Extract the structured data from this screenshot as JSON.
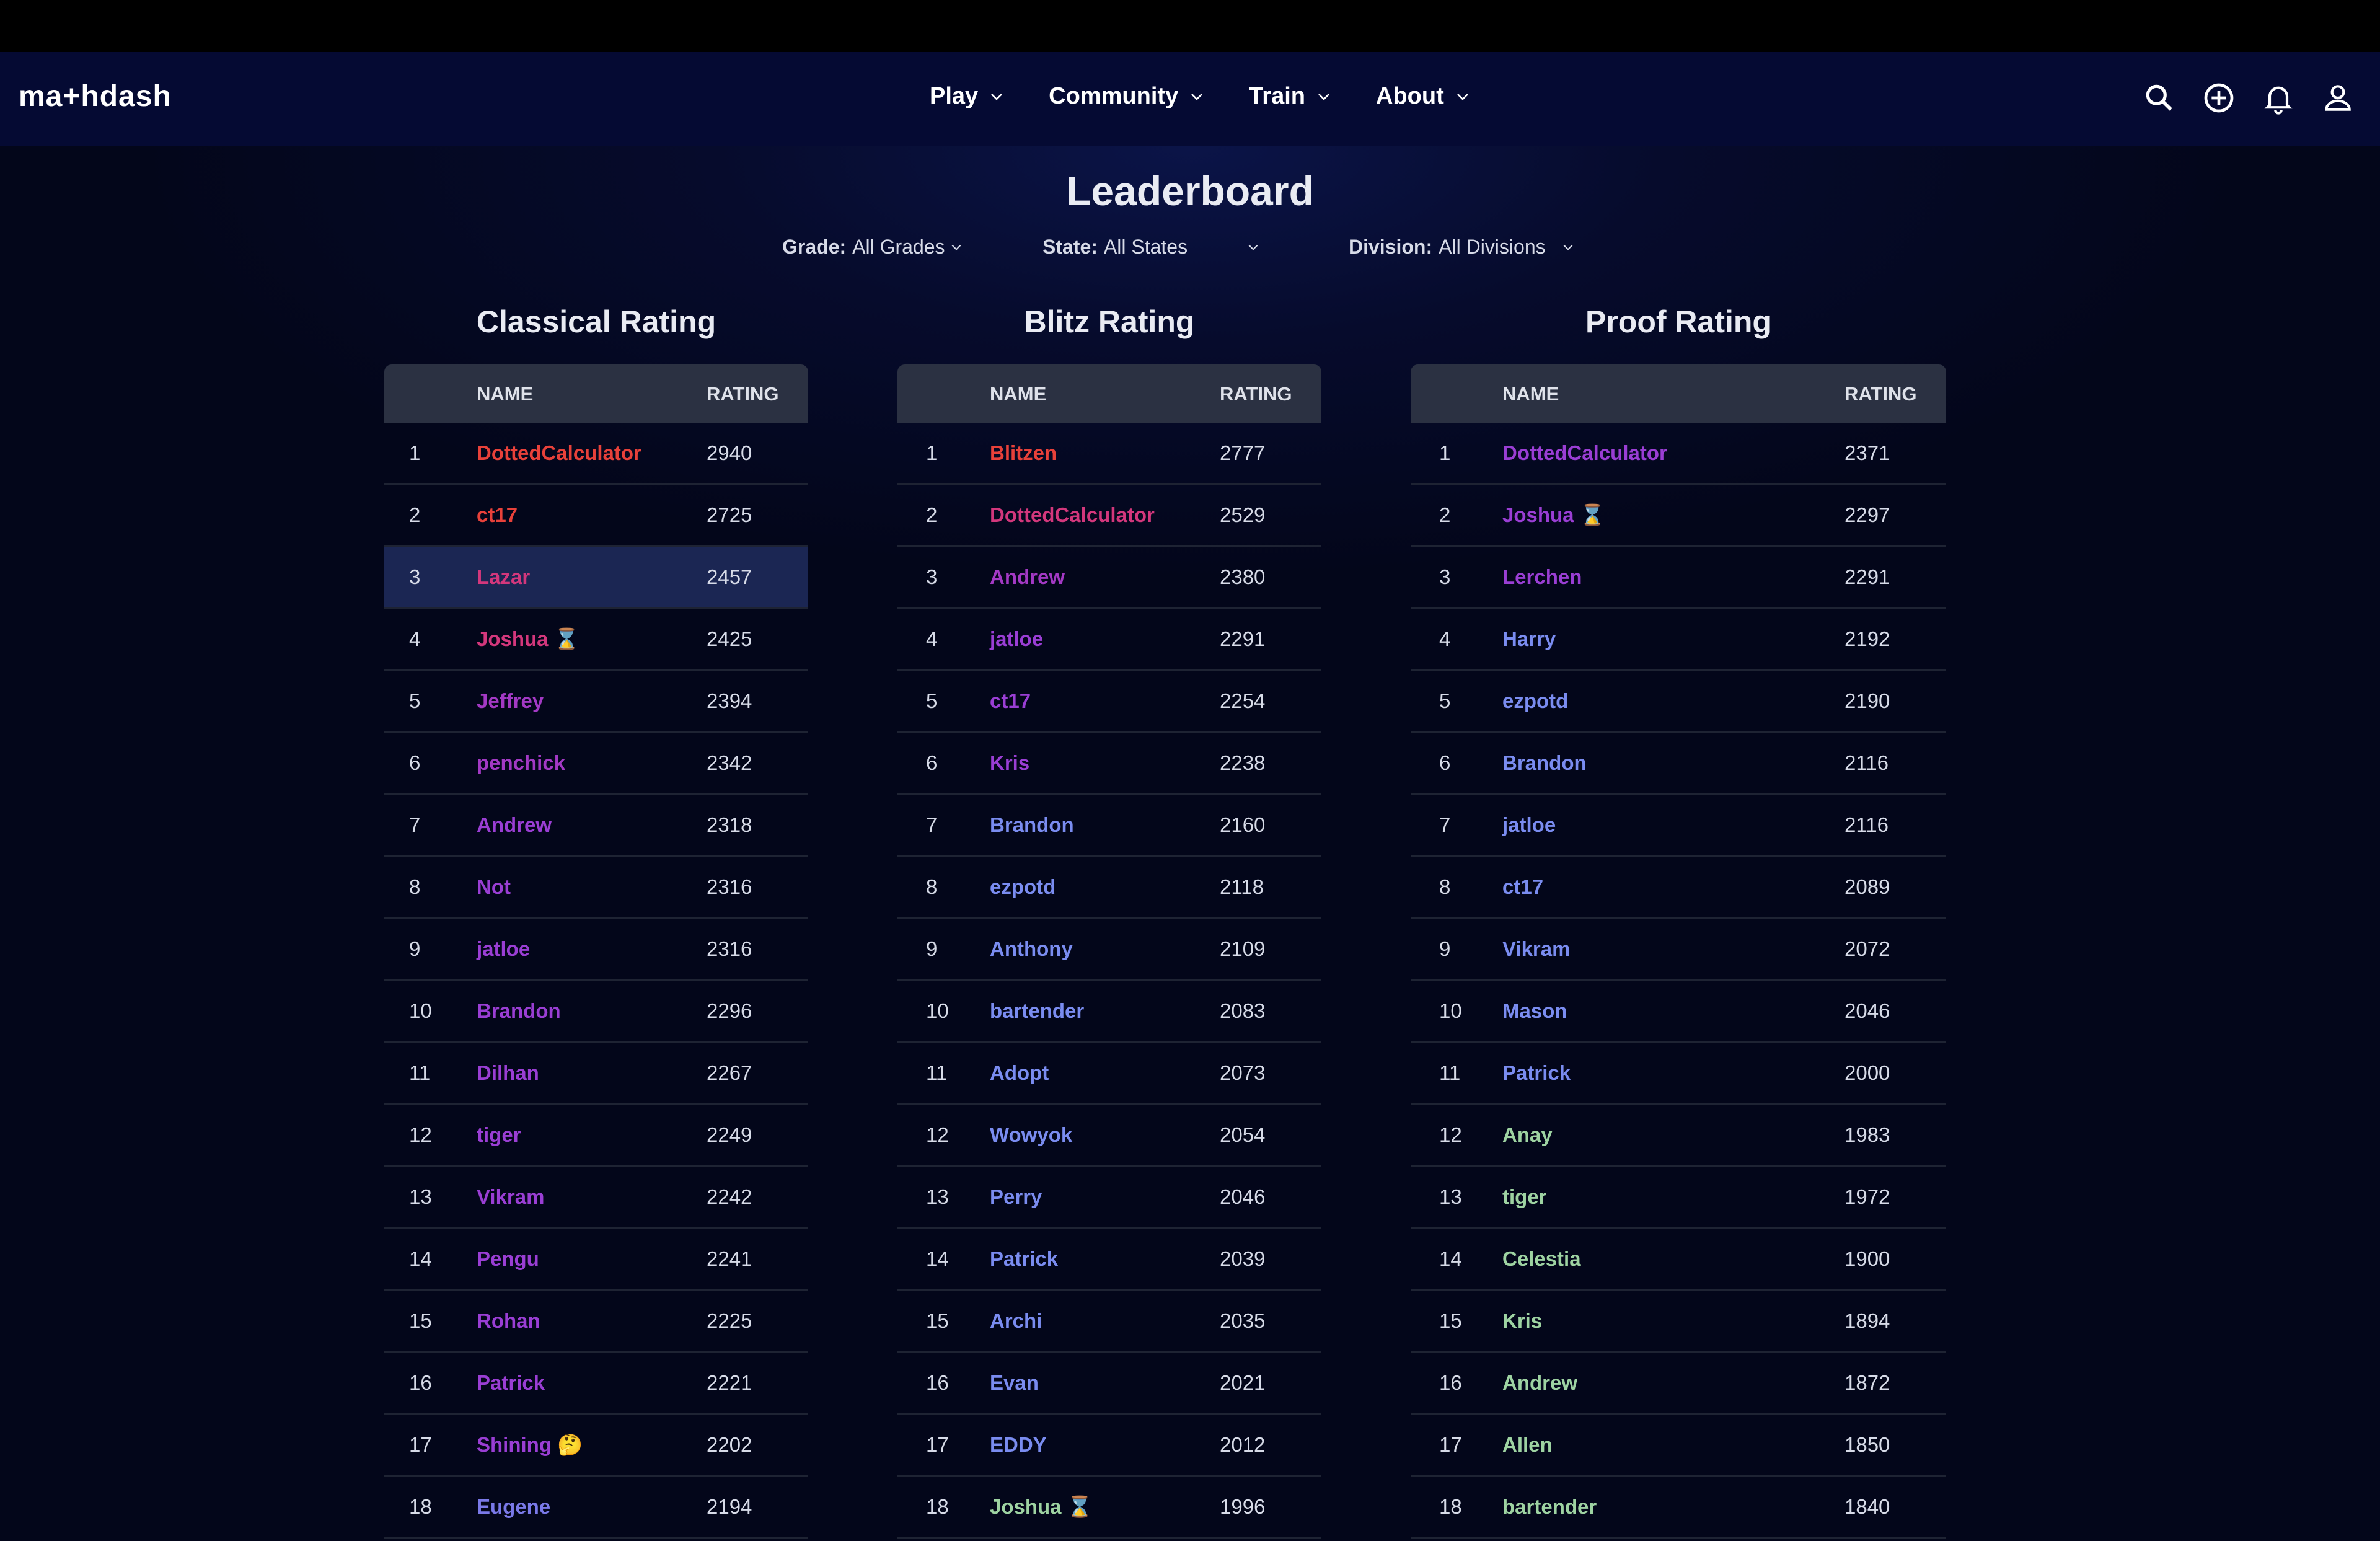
{
  "header": {
    "logo": "ma+hdash",
    "nav": [
      {
        "label": "Play"
      },
      {
        "label": "Community"
      },
      {
        "label": "Train"
      },
      {
        "label": "About"
      }
    ]
  },
  "page": {
    "title": "Leaderboard",
    "filters": {
      "grade_label": "Grade:",
      "grade_value": "All Grades",
      "state_label": "State:",
      "state_value": "All States",
      "division_label": "Division:",
      "division_value": "All Divisions"
    }
  },
  "tables": [
    {
      "title": "Classical Rating",
      "col_name": "NAME",
      "col_rating": "RATING",
      "rows": [
        {
          "rank": "1",
          "name": "DottedCalculator",
          "rating": "2940",
          "color": "#e8413a"
        },
        {
          "rank": "2",
          "name": "ct17",
          "rating": "2725",
          "color": "#e8413a"
        },
        {
          "rank": "3",
          "name": "Lazar",
          "rating": "2457",
          "color": "#d3377c"
        },
        {
          "rank": "4",
          "name": "Joshua ⌛",
          "rating": "2425",
          "color": "#d3377c"
        },
        {
          "rank": "5",
          "name": "Jeffrey",
          "rating": "2394",
          "color": "#a339c4"
        },
        {
          "rank": "6",
          "name": "penchick",
          "rating": "2342",
          "color": "#a339c4"
        },
        {
          "rank": "7",
          "name": "Andrew",
          "rating": "2318",
          "color": "#9a3ed4"
        },
        {
          "rank": "8",
          "name": "Not",
          "rating": "2316",
          "color": "#9a3ed4"
        },
        {
          "rank": "9",
          "name": "jatloe",
          "rating": "2316",
          "color": "#9a3ed4"
        },
        {
          "rank": "10",
          "name": "Brandon",
          "rating": "2296",
          "color": "#9a3ed4"
        },
        {
          "rank": "11",
          "name": "Dilhan",
          "rating": "2267",
          "color": "#9a3ed4"
        },
        {
          "rank": "12",
          "name": "tiger",
          "rating": "2249",
          "color": "#9a3ed4"
        },
        {
          "rank": "13",
          "name": "Vikram",
          "rating": "2242",
          "color": "#9a3ed4"
        },
        {
          "rank": "14",
          "name": "Pengu",
          "rating": "2241",
          "color": "#9a3ed4"
        },
        {
          "rank": "15",
          "name": "Rohan",
          "rating": "2225",
          "color": "#9a3ed4"
        },
        {
          "rank": "16",
          "name": "Patrick",
          "rating": "2221",
          "color": "#9a3ed4"
        },
        {
          "rank": "17",
          "name": "Shining 🤔",
          "rating": "2202",
          "color": "#9a3ed4"
        },
        {
          "rank": "18",
          "name": "Eugene",
          "rating": "2194",
          "color": "#7a79e8"
        }
      ]
    },
    {
      "title": "Blitz Rating",
      "col_name": "NAME",
      "col_rating": "RATING",
      "rows": [
        {
          "rank": "1",
          "name": "Blitzen",
          "rating": "2777",
          "color": "#e8413a"
        },
        {
          "rank": "2",
          "name": "DottedCalculator",
          "rating": "2529",
          "color": "#d3377c"
        },
        {
          "rank": "3",
          "name": "Andrew",
          "rating": "2380",
          "color": "#a339c4"
        },
        {
          "rank": "4",
          "name": "jatloe",
          "rating": "2291",
          "color": "#9a3ed4"
        },
        {
          "rank": "5",
          "name": "ct17",
          "rating": "2254",
          "color": "#9a3ed4"
        },
        {
          "rank": "6",
          "name": "Kris",
          "rating": "2238",
          "color": "#9a3ed4"
        },
        {
          "rank": "7",
          "name": "Brandon",
          "rating": "2160",
          "color": "#7a8cf0"
        },
        {
          "rank": "8",
          "name": "ezpotd",
          "rating": "2118",
          "color": "#7a8cf0"
        },
        {
          "rank": "9",
          "name": "Anthony",
          "rating": "2109",
          "color": "#7a8cf0"
        },
        {
          "rank": "10",
          "name": "bartender",
          "rating": "2083",
          "color": "#7a8cf0"
        },
        {
          "rank": "11",
          "name": "Adopt",
          "rating": "2073",
          "color": "#7a8cf0"
        },
        {
          "rank": "12",
          "name": "Wowyok",
          "rating": "2054",
          "color": "#7a8cf0"
        },
        {
          "rank": "13",
          "name": "Perry",
          "rating": "2046",
          "color": "#7a8cf0"
        },
        {
          "rank": "14",
          "name": "Patrick",
          "rating": "2039",
          "color": "#7a8cf0"
        },
        {
          "rank": "15",
          "name": "Archi",
          "rating": "2035",
          "color": "#7a8cf0"
        },
        {
          "rank": "16",
          "name": "Evan",
          "rating": "2021",
          "color": "#7a8cf0"
        },
        {
          "rank": "17",
          "name": "EDDY",
          "rating": "2012",
          "color": "#7a8cf0"
        },
        {
          "rank": "18",
          "name": "Joshua ⌛",
          "rating": "1996",
          "color": "#9ed3a2"
        }
      ]
    },
    {
      "title": "Proof Rating",
      "col_name": "NAME",
      "col_rating": "RATING",
      "rows": [
        {
          "rank": "1",
          "name": "DottedCalculator",
          "rating": "2371",
          "color": "#9a3ed4"
        },
        {
          "rank": "2",
          "name": "Joshua ⌛",
          "rating": "2297",
          "color": "#9a3ed4"
        },
        {
          "rank": "3",
          "name": "Lerchen",
          "rating": "2291",
          "color": "#9a3ed4"
        },
        {
          "rank": "4",
          "name": "Harry",
          "rating": "2192",
          "color": "#7a8cf0"
        },
        {
          "rank": "5",
          "name": "ezpotd",
          "rating": "2190",
          "color": "#7a8cf0"
        },
        {
          "rank": "6",
          "name": "Brandon",
          "rating": "2116",
          "color": "#7a8cf0"
        },
        {
          "rank": "7",
          "name": "jatloe",
          "rating": "2116",
          "color": "#7a8cf0"
        },
        {
          "rank": "8",
          "name": "ct17",
          "rating": "2089",
          "color": "#7a8cf0"
        },
        {
          "rank": "9",
          "name": "Vikram",
          "rating": "2072",
          "color": "#7a8cf0"
        },
        {
          "rank": "10",
          "name": "Mason",
          "rating": "2046",
          "color": "#7a8cf0"
        },
        {
          "rank": "11",
          "name": "Patrick",
          "rating": "2000",
          "color": "#7a8cf0"
        },
        {
          "rank": "12",
          "name": "Anay",
          "rating": "1983",
          "color": "#9ed3a2"
        },
        {
          "rank": "13",
          "name": "tiger",
          "rating": "1972",
          "color": "#9ed3a2"
        },
        {
          "rank": "14",
          "name": "Celestia",
          "rating": "1900",
          "color": "#9ed3a2"
        },
        {
          "rank": "15",
          "name": "Kris",
          "rating": "1894",
          "color": "#9ed3a2"
        },
        {
          "rank": "16",
          "name": "Andrew",
          "rating": "1872",
          "color": "#9ed3a2"
        },
        {
          "rank": "17",
          "name": "Allen",
          "rating": "1850",
          "color": "#9ed3a2"
        },
        {
          "rank": "18",
          "name": "bartender",
          "rating": "1840",
          "color": "#9ed3a2"
        }
      ]
    }
  ],
  "highlight": {
    "table_index": 0,
    "rank": "3"
  }
}
